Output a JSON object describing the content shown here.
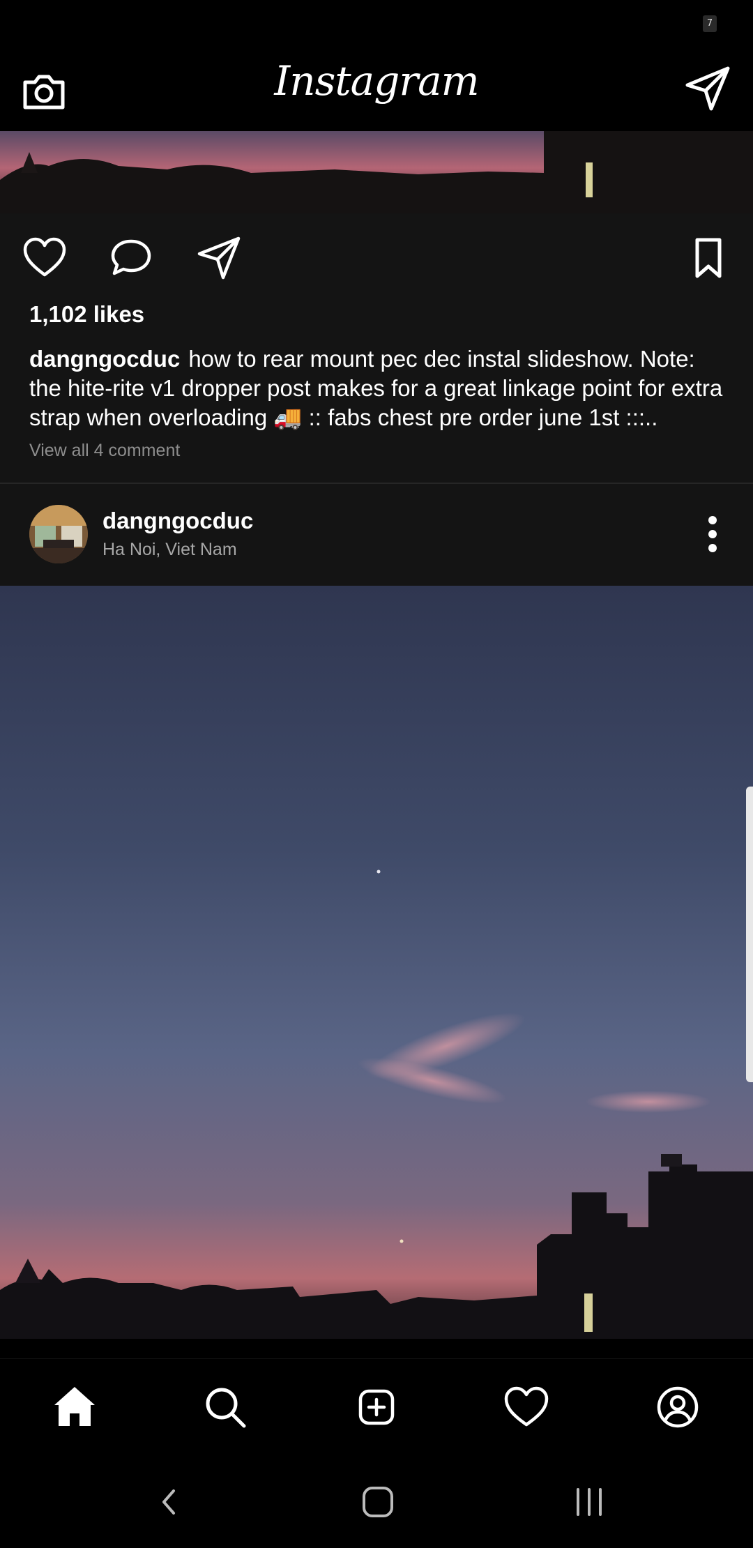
{
  "status_bar": {
    "icon_text": "7"
  },
  "header": {
    "title": "Instagram",
    "camera_icon": "camera-icon",
    "dm_icon": "send-icon"
  },
  "post_actions": {
    "like_icon": "heart-icon",
    "comment_icon": "comment-icon",
    "share_icon": "send-icon",
    "save_icon": "bookmark-icon",
    "likes": "1,102 likes",
    "caption_user": "dangngocduc",
    "caption_text": "how to rear mount pec dec instal slideshow. Note: the hite-rite v1 dropper post makes for a great linkage point for extra strap when overloading 🚚 :: fabs chest pre order june 1st :::..",
    "view_comments": "View all 4 comment"
  },
  "post_header": {
    "username": "dangngocduc",
    "location": "Ha Noi, Viet Nam",
    "more_icon": "more-vertical-icon"
  },
  "bottom_nav": {
    "items": [
      "home-icon",
      "search-icon",
      "add-post-icon",
      "activity-heart-icon",
      "profile-icon"
    ]
  },
  "system_nav": {
    "items": [
      "back-icon",
      "home-button-icon",
      "recents-icon"
    ]
  }
}
